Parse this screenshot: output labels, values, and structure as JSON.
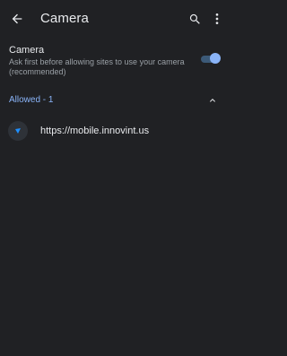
{
  "appbar": {
    "title": "Camera",
    "back_icon": "arrow-back-icon",
    "search_icon": "search-icon",
    "menu_icon": "more-vert-icon"
  },
  "setting": {
    "title": "Camera",
    "summary": "Ask first before allowing sites to use your camera (recommended)",
    "toggle_on": true
  },
  "allowed_section": {
    "label": "Allowed - 1",
    "expanded": true,
    "icon": "chevron-up-icon"
  },
  "sites": [
    {
      "url": "https://mobile.innovint.us",
      "icon": "site-favicon"
    }
  ],
  "colors": {
    "background": "#202124",
    "accent": "#8ab4f8",
    "text_primary": "#e8eaed",
    "text_secondary": "#9aa0a6"
  }
}
